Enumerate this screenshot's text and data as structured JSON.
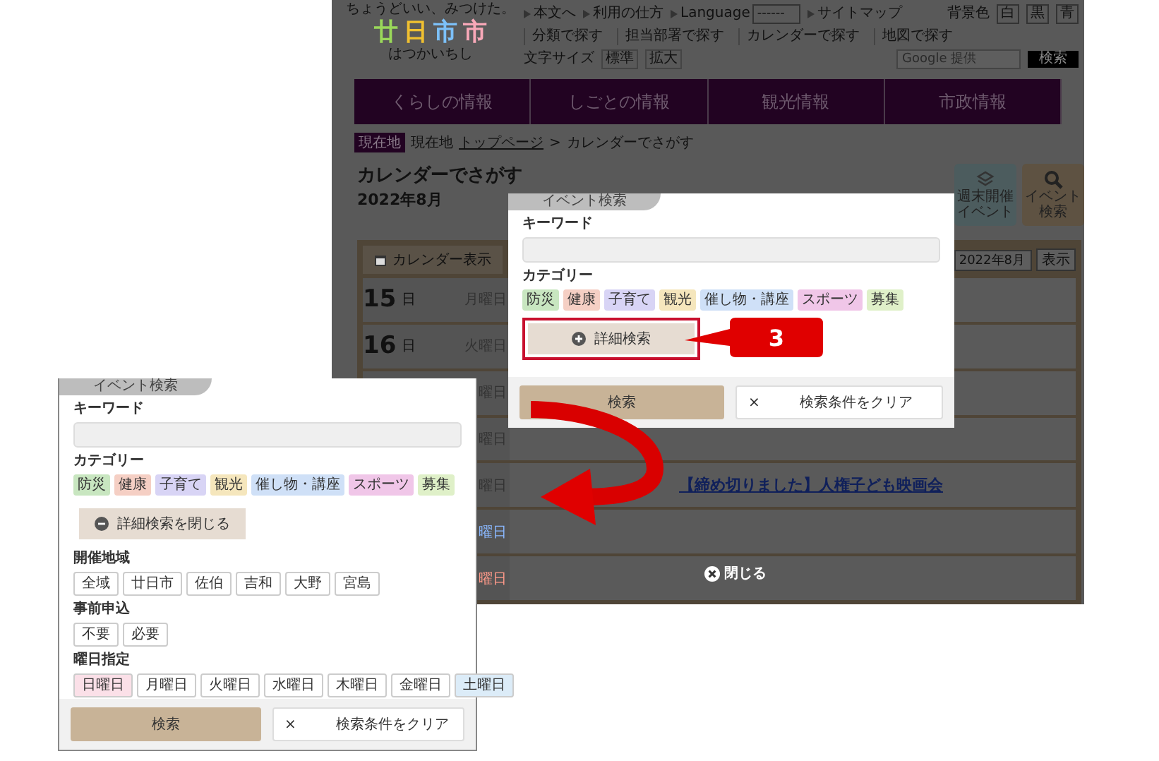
{
  "site": {
    "tagline": "ちょうどいい、みつけた。",
    "logo": {
      "characters": [
        {
          "text": "廿",
          "color": "#9ad85a"
        },
        {
          "text": "日",
          "color": "#f0c030"
        },
        {
          "text": "市",
          "color": "#7cc0f8"
        },
        {
          "text": "市",
          "color": "#f8a8b8"
        }
      ],
      "reading": "はつかいちし"
    },
    "utility_links": [
      {
        "kind": "link",
        "label": "本文へ"
      },
      {
        "kind": "link",
        "label": "利用の仕方"
      },
      {
        "kind": "select",
        "label": "Language",
        "value": "------"
      },
      {
        "kind": "link",
        "label": "サイトマップ"
      }
    ],
    "background_color": {
      "label": "背景色",
      "options": [
        "白",
        "黒",
        "青"
      ]
    },
    "text_size": {
      "label": "文字サイズ",
      "options": [
        "標準",
        "拡大"
      ]
    },
    "search_links": [
      "分類で探す",
      "担当部署で探す",
      "カレンダーで探す",
      "地図で探す"
    ],
    "site_search": {
      "placeholder": "Google 提供",
      "button": "検索"
    },
    "nav": [
      "くらしの情報",
      "しごとの情報",
      "観光情報",
      "市政情報"
    ],
    "breadcrumb": {
      "badge": "現在地",
      "lead": "現在地",
      "link": "トップページ",
      "separator": ">",
      "current": "カレンダーでさがす"
    },
    "title": "カレンダーでさがす",
    "month": "2022年8月",
    "quick_buttons": [
      {
        "kind": "weekend",
        "label": "週末開催イベント"
      },
      {
        "kind": "search",
        "label": "イベント検索"
      }
    ],
    "calendar": {
      "tab": "カレンダー表示",
      "month_select": "2022年8月",
      "show_button": "表示",
      "rows": [
        {
          "day": "15",
          "unit": "日",
          "weekday": "月曜日",
          "color": "#333333"
        },
        {
          "day": "16",
          "unit": "日",
          "weekday": "火曜日",
          "color": "#333333"
        },
        {
          "weekday": "曜日",
          "color": "#333333"
        },
        {
          "weekday": "曜日",
          "color": "#333333"
        },
        {
          "weekday": "曜日",
          "color": "#333333",
          "events": [
            "【締め切りました】人権子ども映画会"
          ]
        },
        {
          "weekday": "曜日",
          "color": "#8ab8ff"
        },
        {
          "weekday": "曜日",
          "color": "#ff9a8a"
        }
      ]
    }
  },
  "popup": {
    "tab": "イベント検索",
    "keyword_label": "キーワード",
    "category_label": "カテゴリー",
    "categories": [
      {
        "label": "防災",
        "color": "#c8e6c0"
      },
      {
        "label": "健康",
        "color": "#f5cfc4"
      },
      {
        "label": "子育て",
        "color": "#d8d4f5"
      },
      {
        "label": "観光",
        "color": "#f5e6bc"
      },
      {
        "label": "催し物・講座",
        "color": "#cfe0f7"
      },
      {
        "label": "スポーツ",
        "color": "#f0c6e8"
      },
      {
        "label": "募集",
        "color": "#dff0c8"
      }
    ],
    "detail_toggle": {
      "label": "詳細検索",
      "expanded": false,
      "highlighted": true
    },
    "buttons": [
      {
        "kind": "primary",
        "label": "検索"
      },
      {
        "kind": "clear",
        "icon": "×",
        "label": "検索条件をクリア"
      }
    ]
  },
  "expanded_panel": {
    "tab": "イベント検索",
    "keyword_label": "キーワード",
    "category_label": "カテゴリー",
    "categories": [
      {
        "label": "防災",
        "color": "#c8e6c0"
      },
      {
        "label": "健康",
        "color": "#f5cfc4"
      },
      {
        "label": "子育て",
        "color": "#d8d4f5"
      },
      {
        "label": "観光",
        "color": "#f5e6bc"
      },
      {
        "label": "催し物・講座",
        "color": "#cfe0f7"
      },
      {
        "label": "スポーツ",
        "color": "#f0c6e8"
      },
      {
        "label": "募集",
        "color": "#dff0c8"
      }
    ],
    "detail_toggle": {
      "label": "詳細検索を閉じる",
      "expanded": true,
      "highlighted": false
    },
    "filters": [
      {
        "label": "開催地域",
        "options": [
          {
            "label": "全域",
            "color": "#ffffff"
          },
          {
            "label": "廿日市",
            "color": "#ffffff"
          },
          {
            "label": "佐伯",
            "color": "#ffffff"
          },
          {
            "label": "吉和",
            "color": "#ffffff"
          },
          {
            "label": "大野",
            "color": "#ffffff"
          },
          {
            "label": "宮島",
            "color": "#ffffff"
          }
        ]
      },
      {
        "label": "事前申込",
        "options": [
          {
            "label": "不要",
            "color": "#ffffff"
          },
          {
            "label": "必要",
            "color": "#ffffff"
          }
        ]
      },
      {
        "label": "曜日指定",
        "options": [
          {
            "label": "日曜日",
            "color": "#fbe0e8"
          },
          {
            "label": "月曜日",
            "color": "#ffffff"
          },
          {
            "label": "火曜日",
            "color": "#ffffff"
          },
          {
            "label": "水曜日",
            "color": "#ffffff"
          },
          {
            "label": "木曜日",
            "color": "#ffffff"
          },
          {
            "label": "金曜日",
            "color": "#ffffff"
          },
          {
            "label": "土曜日",
            "color": "#dcecf8"
          }
        ]
      }
    ],
    "buttons": [
      {
        "kind": "primary",
        "label": "検索"
      },
      {
        "kind": "clear",
        "icon": "×",
        "label": "検索条件をクリア"
      }
    ]
  },
  "callout": {
    "text": "3"
  },
  "close_button": "閉じる"
}
